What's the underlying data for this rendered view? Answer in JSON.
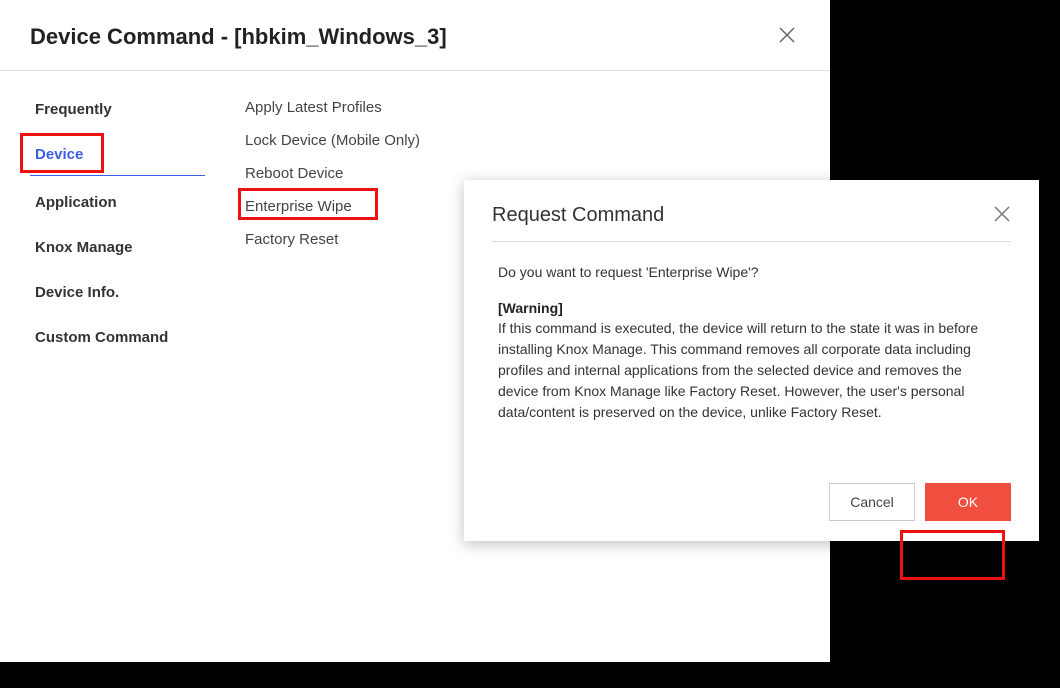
{
  "window": {
    "title": "Device Command - [hbkim_Windows_3]"
  },
  "sidebar": {
    "items": [
      {
        "label": "Frequently"
      },
      {
        "label": "Device"
      },
      {
        "label": "Application"
      },
      {
        "label": "Knox Manage"
      },
      {
        "label": "Device Info."
      },
      {
        "label": "Custom Command"
      }
    ]
  },
  "commands": {
    "items": [
      {
        "label": "Apply Latest Profiles"
      },
      {
        "label": "Lock Device (Mobile Only)"
      },
      {
        "label": "Reboot Device"
      },
      {
        "label": "Enterprise Wipe"
      },
      {
        "label": "Factory Reset"
      }
    ]
  },
  "modal": {
    "title": "Request Command",
    "question": "Do you want to request 'Enterprise Wipe'?",
    "warning_label": "[Warning]",
    "warning_text": "If this command is executed, the device will return to the state it was in before installing Knox Manage. This command removes all corporate data including profiles and internal applications from the selected device and removes the device from Knox Manage like Factory Reset. However, the user's personal data/content is preserved on the device, unlike Factory Reset.",
    "cancel_label": "Cancel",
    "ok_label": "OK"
  }
}
